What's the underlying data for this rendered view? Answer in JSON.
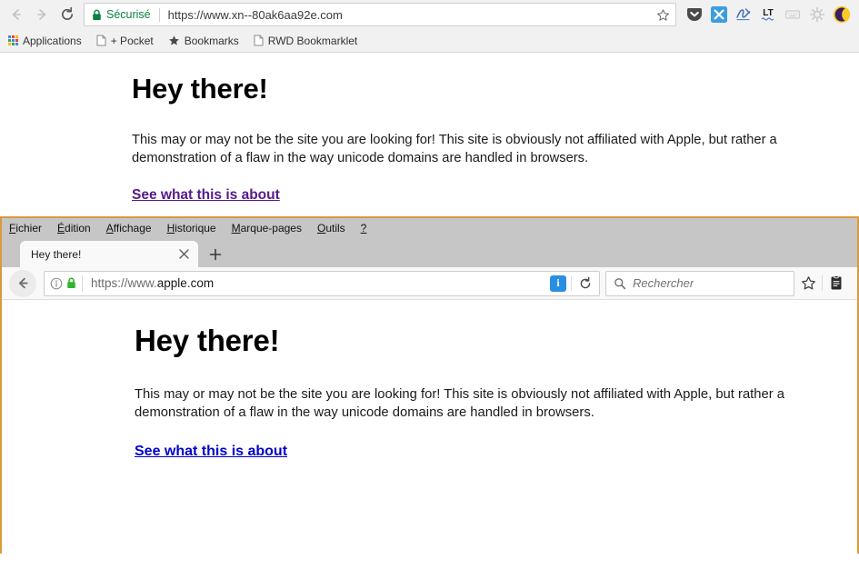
{
  "chrome_window": {
    "nav": {
      "back_icon": "arrow-left-icon",
      "forward_icon": "arrow-right-icon",
      "reload_icon": "reload-icon"
    },
    "omnibox": {
      "lock_icon": "lock-icon",
      "secure_label": "Sécurisé",
      "url": "https://www.xn--80ak6aa92e.com",
      "star_icon": "star-icon"
    },
    "extensions": [
      {
        "name": "pocket-extension-icon",
        "label": "Pocket"
      },
      {
        "name": "x-extension-icon",
        "label": "X"
      },
      {
        "name": "signature-extension-icon",
        "label": "Signature"
      },
      {
        "name": "languagetool-extension-icon",
        "label": "LT"
      },
      {
        "name": "keyboard-extension-icon",
        "label": "Keyboard"
      },
      {
        "name": "gear-extension-icon",
        "label": "Settings"
      },
      {
        "name": "moon-extension-icon",
        "label": "Night mode"
      }
    ],
    "bookmarks": [
      {
        "name": "bookmark-applications",
        "icon": "apps-grid-icon",
        "label": "Applications"
      },
      {
        "name": "bookmark-pocket",
        "icon": "page-icon",
        "label": "+ Pocket"
      },
      {
        "name": "bookmark-bookmarks",
        "icon": "star-filled-icon",
        "label": "Bookmarks"
      },
      {
        "name": "bookmark-rwd",
        "icon": "page-icon",
        "label": "RWD Bookmarklet"
      }
    ],
    "page": {
      "heading": "Hey there!",
      "paragraph": "This may or may not be the site you are looking for! This site is obviously not affiliated with Apple, but rather a demonstration of a flaw in the way unicode domains are handled in browsers.",
      "link_text": "See what this is about",
      "link_color": "#551a8b"
    }
  },
  "firefox_window": {
    "window_border_color": "#d99a3c",
    "menubar": [
      {
        "name": "menu-fichier",
        "accel": "F",
        "rest": "ichier"
      },
      {
        "name": "menu-edition",
        "accel": "É",
        "rest": "dition"
      },
      {
        "name": "menu-affichage",
        "accel": "A",
        "rest": "ffichage"
      },
      {
        "name": "menu-historique",
        "accel": "H",
        "rest": "istorique"
      },
      {
        "name": "menu-marque-pages",
        "accel": "M",
        "rest": "arque-pages"
      },
      {
        "name": "menu-outils",
        "accel": "O",
        "rest": "utils"
      },
      {
        "name": "menu-aide",
        "accel": "?",
        "rest": ""
      }
    ],
    "tab": {
      "title": "Hey there!",
      "close_icon": "close-icon",
      "newtab_icon": "plus-icon"
    },
    "navbar": {
      "back_icon": "arrow-left-icon",
      "info_icon": "info-circle-icon",
      "lock_icon": "lock-icon",
      "url_scheme": "https://www.",
      "url_domain": "apple.com",
      "page_action_badge": "i",
      "reload_icon": "reload-icon",
      "search_icon": "search-icon",
      "search_placeholder": "Rechercher",
      "search_value": "",
      "bookmark_star_icon": "star-icon",
      "library_icon": "library-icon"
    },
    "page": {
      "heading": "Hey there!",
      "paragraph": "This may or may not be the site you are looking for! This site is obviously not affiliated with Apple, but rather a demonstration of a flaw in the way unicode domains are handled in browsers.",
      "link_text": "See what this is about",
      "link_color": "#0000cc"
    }
  }
}
